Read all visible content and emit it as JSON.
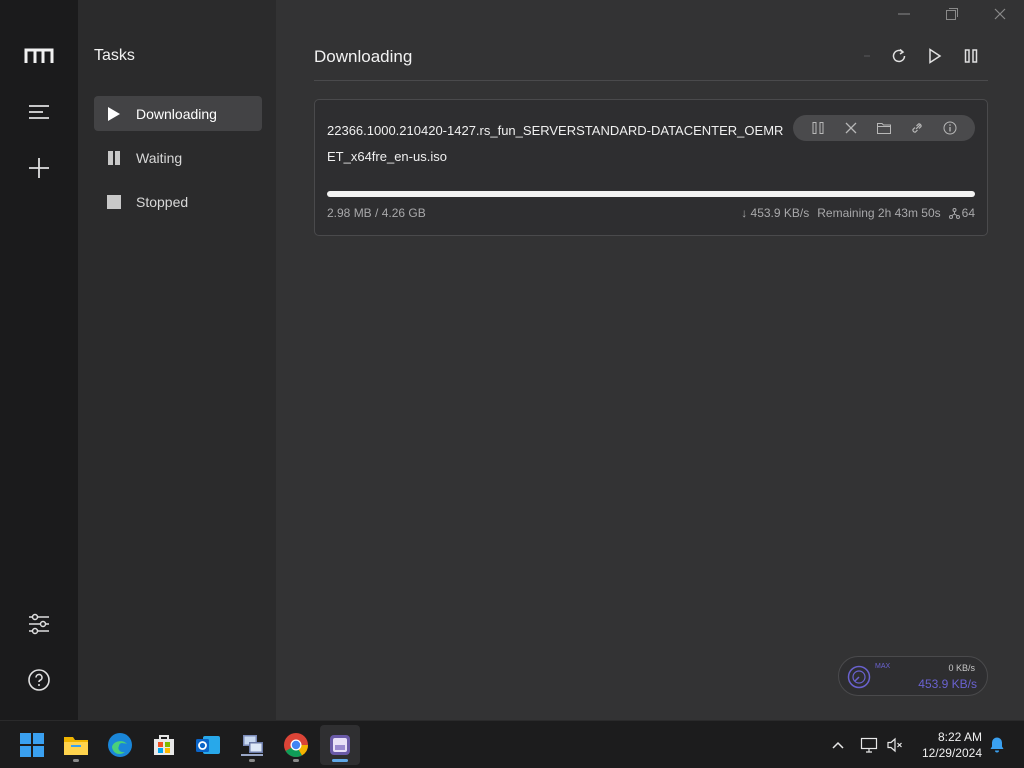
{
  "sidebar": {
    "title": "Tasks",
    "items": [
      {
        "label": "Downloading",
        "icon": "play-icon",
        "active": true
      },
      {
        "label": "Waiting",
        "icon": "pause-icon",
        "active": false
      },
      {
        "label": "Stopped",
        "icon": "stop-icon",
        "active": false
      }
    ]
  },
  "main": {
    "heading": "Downloading"
  },
  "task": {
    "file_name": "22366.1000.210420-1427.rs_fun_SERVERSTANDARD-DATACENTER_OEMRET_x64fre_en-us.iso",
    "size_progress": "2.98 MB / 4.26 GB",
    "speed": "↓ 453.9 KB/s",
    "remaining": "Remaining 2h 43m 50s",
    "connections": "64",
    "progress_fraction": 1.0
  },
  "speed_widget": {
    "max_label": "MAX",
    "upload": "0 KB/s",
    "download": "453.9 KB/s"
  },
  "taskbar": {
    "time": "8:22 AM",
    "date": "12/29/2024"
  },
  "colors": {
    "accent": "#6a62d0",
    "taskbar_active": "#60a8e8",
    "panel_bg": "#2b2b2c",
    "main_bg": "#333334"
  }
}
